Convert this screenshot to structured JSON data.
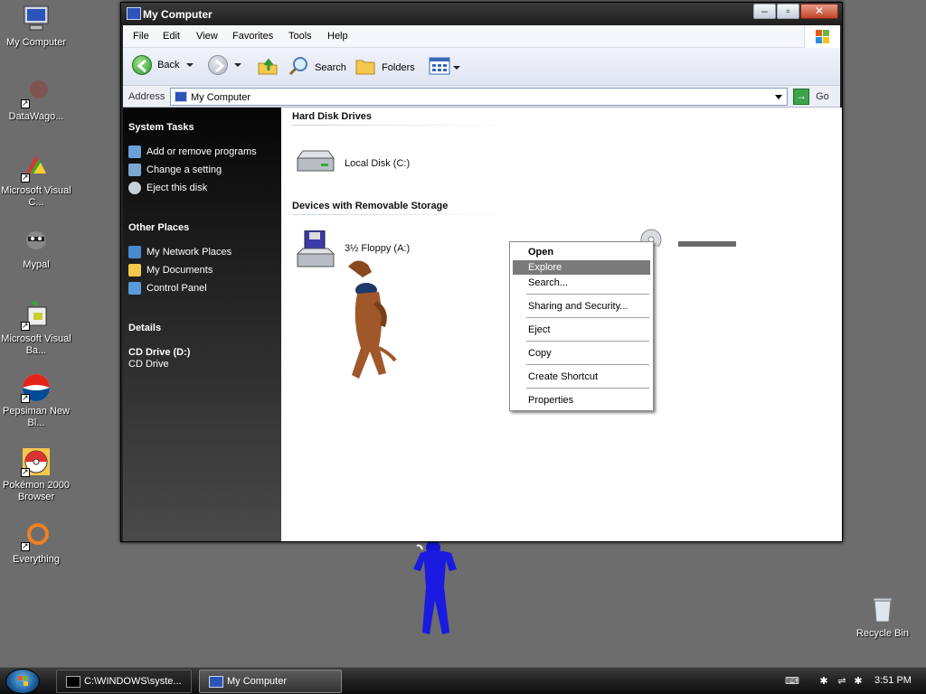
{
  "desktop": {
    "icons": [
      {
        "label": "My Computer"
      },
      {
        "label": "DataWago..."
      },
      {
        "label": "Microsoft Visual C..."
      },
      {
        "label": "Mypal"
      },
      {
        "label": "Microsoft Visual Ba..."
      },
      {
        "label": "Pepsiman New Bl..."
      },
      {
        "label": "Pokémon 2000 Browser"
      },
      {
        "label": "Everything"
      },
      {
        "label": "Recycle Bin"
      }
    ]
  },
  "window": {
    "title": "My Computer",
    "menu": [
      "File",
      "Edit",
      "View",
      "Favorites",
      "Tools",
      "Help"
    ],
    "toolbar": {
      "back": "Back",
      "search": "Search",
      "folders": "Folders"
    },
    "address": {
      "label": "Address",
      "value": "My Computer",
      "go": "Go"
    },
    "sidebar": {
      "system_tasks_title": "System Tasks",
      "system_tasks": [
        "Add or remove programs",
        "Change a setting",
        "Eject this disk"
      ],
      "other_places_title": "Other Places",
      "other_places": [
        "My Network Places",
        "My Documents",
        "Control Panel"
      ],
      "details_title": "Details",
      "details_name": "CD Drive (D:)",
      "details_type": "CD Drive"
    },
    "content": {
      "hard_disk_title": "Hard Disk Drives",
      "local_disk": "Local Disk (C:)",
      "removable_title": "Devices with Removable Storage",
      "floppy": "3½ Floppy (A:)"
    }
  },
  "context_menu": {
    "items": [
      "Open",
      "Explore",
      "Search...",
      "Sharing and Security...",
      "Eject",
      "Copy",
      "Create Shortcut",
      "Properties"
    ],
    "highlighted": "Explore"
  },
  "taskbar": {
    "tasks": [
      "C:\\WINDOWS\\syste...",
      "My Computer"
    ],
    "clock": "3:51 PM"
  },
  "colors": {
    "desktop_bg": "#6d6d6d",
    "sidebar_bg": "#1a1a1a",
    "menu_highlight": "#7a7a7a",
    "taskbar_bg": "#1c1c1c"
  }
}
